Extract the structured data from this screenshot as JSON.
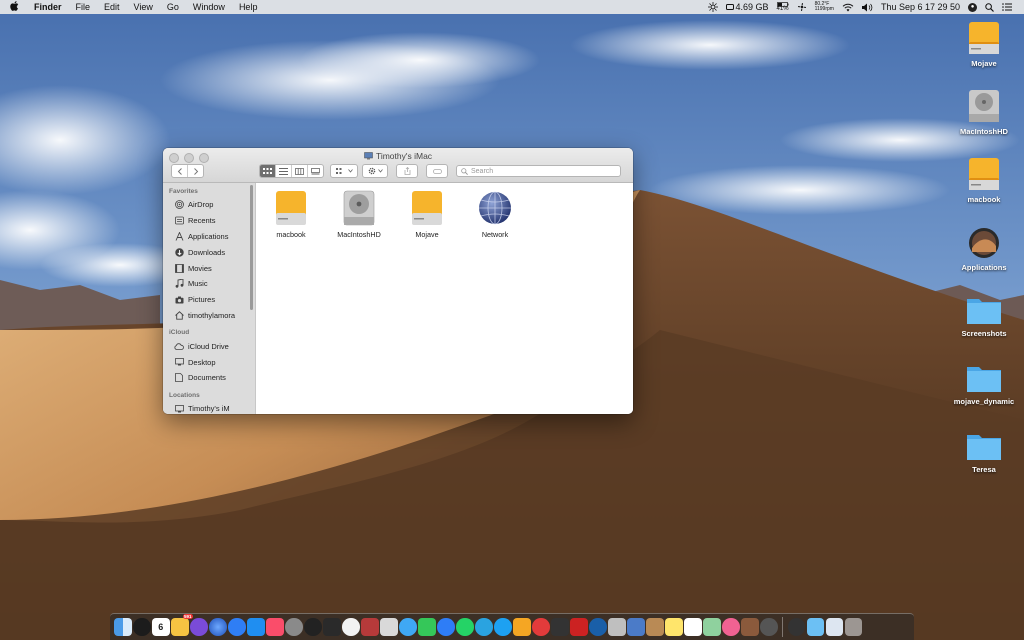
{
  "menubar": {
    "app_name": "Finder",
    "items": [
      "File",
      "Edit",
      "View",
      "Go",
      "Window",
      "Help"
    ],
    "disk_free": "4.69 GB",
    "battery_percent": "41%",
    "cpu_temp": "80.2°F",
    "fan_rpm": "1199rpm",
    "clock": "Thu Sep 6  17 29 50"
  },
  "desktop_icons": [
    {
      "label": "Mojave",
      "icon": "orange-drive-icon"
    },
    {
      "label": "MacIntoshHD",
      "icon": "internal-drive-icon"
    },
    {
      "label": "macbook",
      "icon": "orange-drive-icon"
    },
    {
      "label": "Applications",
      "icon": "applications-icon"
    },
    {
      "label": "Screenshots",
      "icon": "folder-icon"
    },
    {
      "label": "mojave_dynamic",
      "icon": "folder-icon"
    },
    {
      "label": "Teresa",
      "icon": "folder-icon"
    }
  ],
  "window": {
    "title": "Timothy's iMac",
    "search_placeholder": "Search",
    "sidebar": {
      "favorites_header": "Favorites",
      "favorites": [
        "AirDrop",
        "Recents",
        "Applications",
        "Downloads",
        "Movies",
        "Music",
        "Pictures",
        "timothylamora"
      ],
      "icloud_header": "iCloud",
      "icloud": [
        "iCloud Drive",
        "Desktop",
        "Documents"
      ],
      "locations_header": "Locations",
      "locations": [
        "Timothy's iM"
      ]
    },
    "items": [
      {
        "label": "macbook",
        "icon": "orange-drive-icon"
      },
      {
        "label": "MacIntoshHD",
        "icon": "internal-drive-icon"
      },
      {
        "label": "Mojave",
        "icon": "orange-drive-icon"
      },
      {
        "label": "Network",
        "icon": "network-globe-icon"
      }
    ]
  },
  "dock": {
    "calendar_day": "6",
    "badge": "591"
  },
  "colors": {
    "sky_top": "#4a6fa8",
    "sky_bottom": "#8fb0d8",
    "dune_light": "#d9a66a",
    "dune_dark": "#5e3f27",
    "drive_orange": "#f5a623",
    "folder_blue": "#5db4ee"
  }
}
